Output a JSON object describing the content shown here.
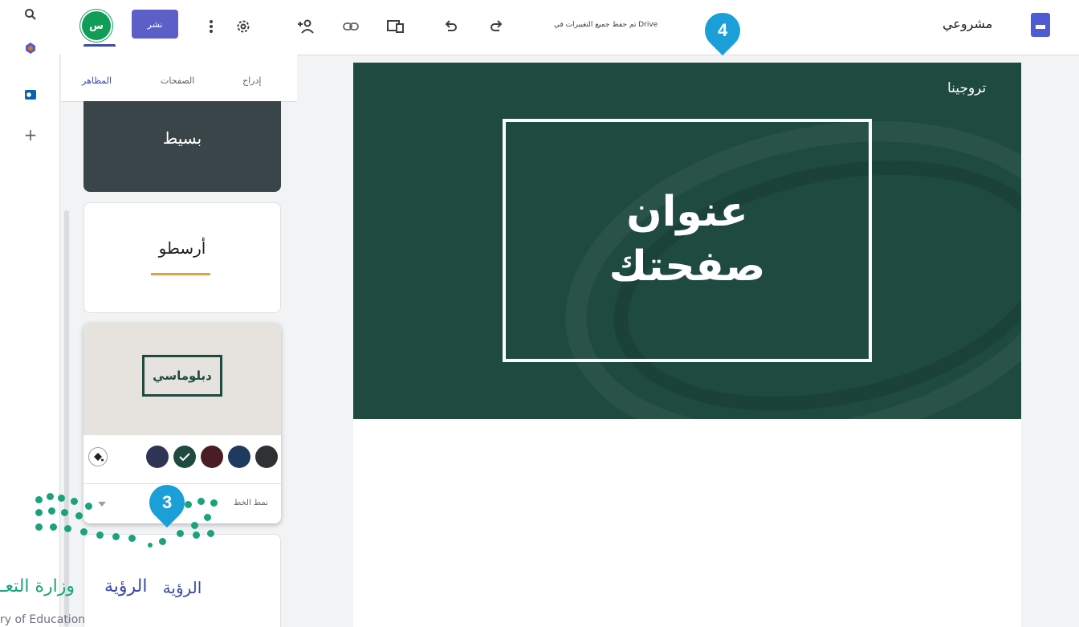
{
  "app_strip": {
    "icons": [
      "search-icon",
      "gemini-icon",
      "outlook-icon",
      "plus-icon"
    ]
  },
  "toolbar": {
    "avatar_initials": "س",
    "publish_label": "نشر",
    "saved_status": "تم حفظ جميع التغييرات في Drive",
    "doc_title": "مشروعي",
    "icons": [
      "more-vert-icon",
      "settings-icon",
      "share-person-icon",
      "link-icon",
      "preview-icon",
      "undo-icon",
      "redo-icon"
    ]
  },
  "panel": {
    "tabs": {
      "insert": "إدراج",
      "pages": "الصفحات",
      "themes": "المظاهر"
    },
    "themes": {
      "simple": "بسيط",
      "aristotle": "أرسطو",
      "diplomatic": "دبلوماسي",
      "vision": "الرؤية"
    },
    "font_style_label": "نمط الخط",
    "swatch_colors": [
      "#2f3133",
      "#1e3a5f",
      "#4a1c24",
      "#1f4a3f",
      "#2f3454"
    ]
  },
  "canvas": {
    "site_name": "تروجينا",
    "page_title_line1": "عنوان",
    "page_title_line2": "صفحتك"
  },
  "markers": {
    "top": "4",
    "bottom": "3"
  },
  "watermark": {
    "ar_vision": "الرؤية",
    "ar_ministry": "وزارة التعـ",
    "en": "ry of Education"
  },
  "colors": {
    "accent": "#3c4aa8",
    "theme_green": "#1f4a3f",
    "publish": "#5b5fc7",
    "marker": "#1a9fd9"
  }
}
